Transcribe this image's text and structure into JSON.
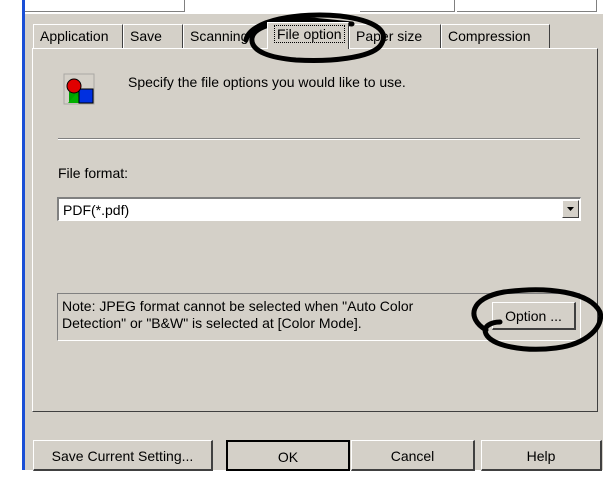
{
  "tabs": [
    {
      "label": "Application",
      "active": false
    },
    {
      "label": "Save",
      "active": false
    },
    {
      "label": "Scanning",
      "active": false
    },
    {
      "label": "File option",
      "active": true
    },
    {
      "label": "Paper size",
      "active": false
    },
    {
      "label": "Compression",
      "active": false
    }
  ],
  "panel": {
    "instruction": "Specify the file options you would like to use.",
    "file_format_label": "File format:",
    "file_format_value": "PDF(*.pdf)",
    "note": "Note: JPEG format cannot be selected when \"Auto Color Detection\" or \"B&W\" is selected at [Color Mode].",
    "option_button": "Option ..."
  },
  "footer": {
    "save_current": "Save Current Setting...",
    "ok": "OK",
    "cancel": "Cancel",
    "help": "Help"
  },
  "colors": {
    "dialog_bg": "#d4d0c8",
    "accent_rule": "#1a4fd6",
    "annotation": "#000000"
  },
  "icons": {
    "info_icon": "shapes-icon",
    "dropdown": "chevron-down-icon"
  }
}
